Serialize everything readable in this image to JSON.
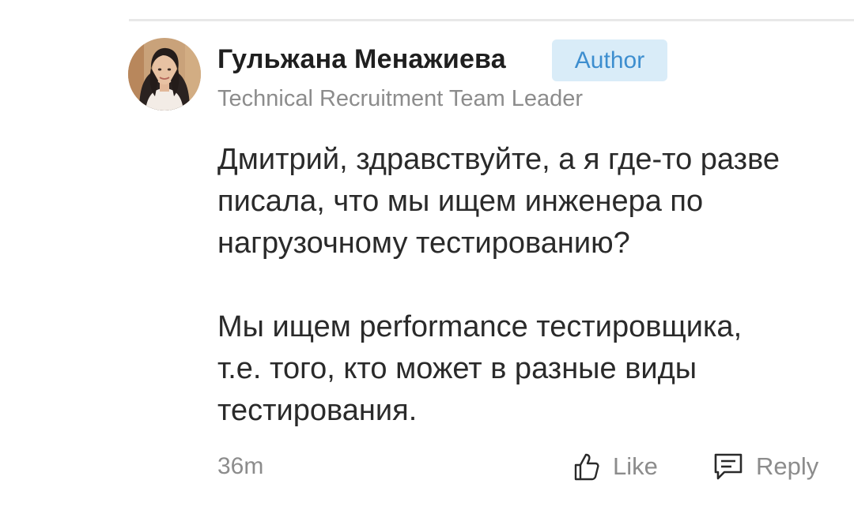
{
  "comment": {
    "author": {
      "name": "Гульжана Менажиева",
      "badge": "Author",
      "title": "Technical Recruitment Team Leader",
      "avatar_icon": "avatar-photo"
    },
    "paragraphs": [
      "Дмитрий, здравствуйте, а я где-то разве\nписала, что мы ищем инженера по\nнагрузочному тестированию?",
      "Мы ищем performance тестировщика,\nт.е. того, кто может в разные виды\nтестирования."
    ],
    "timestamp": "36m",
    "actions": {
      "like": {
        "label": "Like",
        "icon": "thumbs-up-icon"
      },
      "reply": {
        "label": "Reply",
        "icon": "reply-icon"
      }
    }
  },
  "colors": {
    "name": "#1f1f1f",
    "body_text": "#2a2a2a",
    "muted": "#8c8c8c",
    "badge_bg": "#d9ecf8",
    "badge_text": "#3d8ecf",
    "divider": "#e8e8e8"
  }
}
